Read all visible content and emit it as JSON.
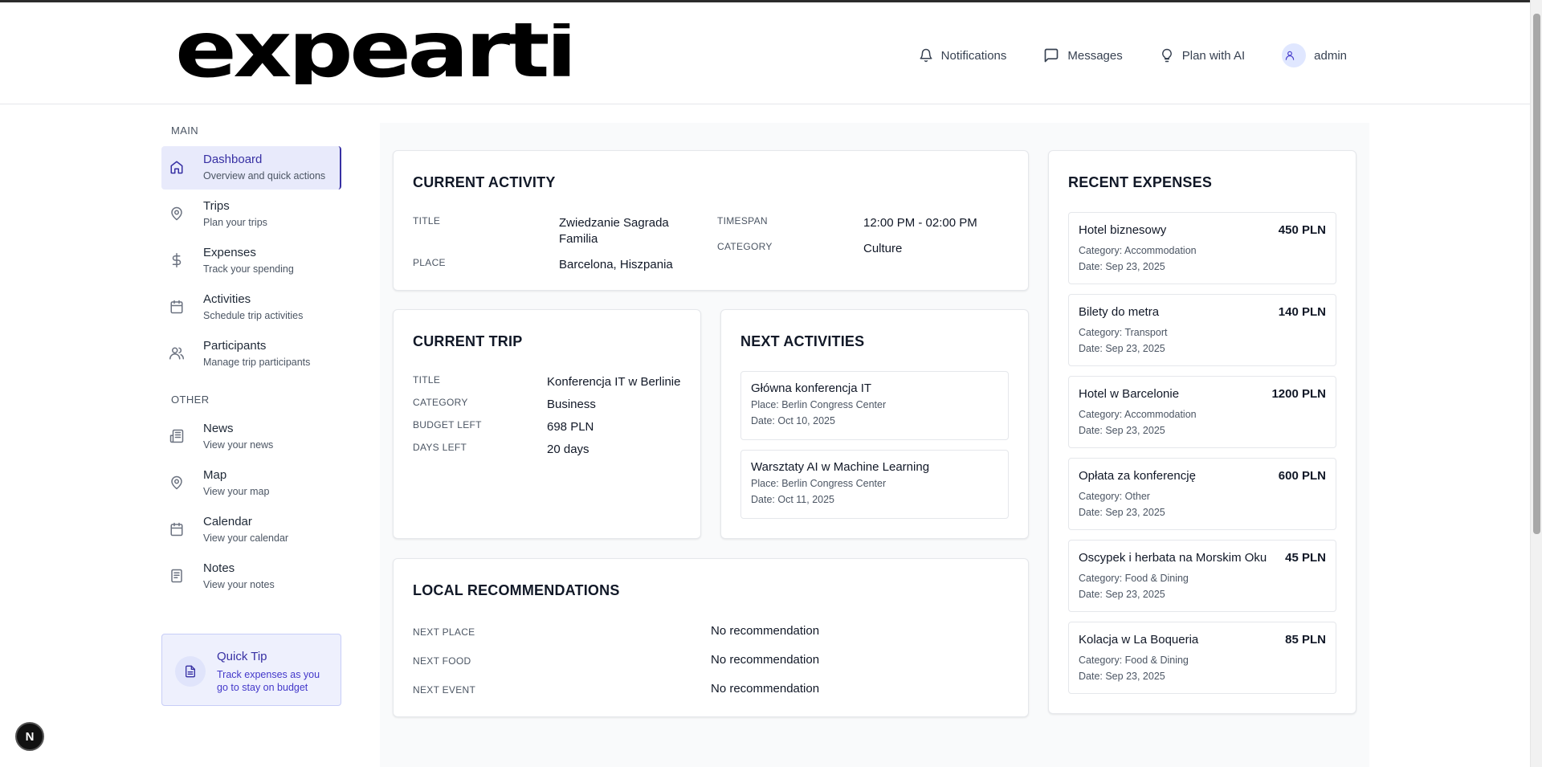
{
  "header": {
    "logo_text": "expearti",
    "nav": {
      "notifications": "Notifications",
      "messages": "Messages",
      "plan_ai": "Plan with AI",
      "user": "admin"
    }
  },
  "sidebar": {
    "main_label": "MAIN",
    "main_items": [
      {
        "title": "Dashboard",
        "sub": "Overview and quick actions",
        "icon": "home-icon"
      },
      {
        "title": "Trips",
        "sub": "Plan your trips",
        "icon": "map-pin-icon"
      },
      {
        "title": "Expenses",
        "sub": "Track your spending",
        "icon": "dollar-icon"
      },
      {
        "title": "Activities",
        "sub": "Schedule trip activities",
        "icon": "calendar-icon"
      },
      {
        "title": "Participants",
        "sub": "Manage trip participants",
        "icon": "users-icon"
      }
    ],
    "other_label": "OTHER",
    "other_items": [
      {
        "title": "News",
        "sub": "View your news",
        "icon": "newspaper-icon"
      },
      {
        "title": "Map",
        "sub": "View your map",
        "icon": "map-pin-icon"
      },
      {
        "title": "Calendar",
        "sub": "View your calendar",
        "icon": "calendar-icon"
      },
      {
        "title": "Notes",
        "sub": "View your notes",
        "icon": "notes-icon"
      }
    ],
    "tip": {
      "title": "Quick Tip",
      "text": "Track expenses as you go to stay on budget"
    }
  },
  "current_activity": {
    "heading": "CURRENT ACTIVITY",
    "title_label": "TITLE",
    "title": "Zwiedzanie Sagrada Familia",
    "place_label": "PLACE",
    "place": "Barcelona, Hiszpania",
    "timespan_label": "TIMESPAN",
    "timespan": "12:00 PM - 02:00 PM",
    "category_label": "CATEGORY",
    "category": "Culture"
  },
  "current_trip": {
    "heading": "CURRENT TRIP",
    "title_label": "TITLE",
    "title": "Konferencja IT w Berlinie",
    "category_label": "CATEGORY",
    "category": "Business",
    "budget_label": "BUDGET LEFT",
    "budget": "698 PLN",
    "days_label": "DAYS LEFT",
    "days": "20 days"
  },
  "next_activities": {
    "heading": "NEXT ACTIVITIES",
    "items": [
      {
        "title": "Główna konferencja IT",
        "place": "Place: Berlin Congress Center",
        "date": "Date: Oct 10, 2025"
      },
      {
        "title": "Warsztaty AI w Machine Learning",
        "place": "Place: Berlin Congress Center",
        "date": "Date: Oct 11, 2025"
      }
    ]
  },
  "local_recommendations": {
    "heading": "LOCAL RECOMMENDATIONS",
    "rows": [
      {
        "label": "NEXT PLACE",
        "value": "No recommendation"
      },
      {
        "label": "NEXT FOOD",
        "value": "No recommendation"
      },
      {
        "label": "NEXT EVENT",
        "value": "No recommendation"
      }
    ]
  },
  "recent_expenses": {
    "heading": "RECENT EXPENSES",
    "items": [
      {
        "title": "Hotel biznesowy",
        "amount": "450 PLN",
        "category": "Category: Accommodation",
        "date": "Date: Sep 23, 2025"
      },
      {
        "title": "Bilety do metra",
        "amount": "140 PLN",
        "category": "Category: Transport",
        "date": "Date: Sep 23, 2025"
      },
      {
        "title": "Hotel w Barcelonie",
        "amount": "1200 PLN",
        "category": "Category: Accommodation",
        "date": "Date: Sep 23, 2025"
      },
      {
        "title": "Opłata za konferencję",
        "amount": "600 PLN",
        "category": "Category: Other",
        "date": "Date: Sep 23, 2025"
      },
      {
        "title": "Oscypek i herbata na Morskim Oku",
        "amount": "45 PLN",
        "category": "Category: Food & Dining",
        "date": "Date: Sep 23, 2025"
      },
      {
        "title": "Kolacja w La Boqueria",
        "amount": "85 PLN",
        "category": "Category: Food & Dining",
        "date": "Date: Sep 23, 2025"
      }
    ]
  },
  "badge": "N"
}
